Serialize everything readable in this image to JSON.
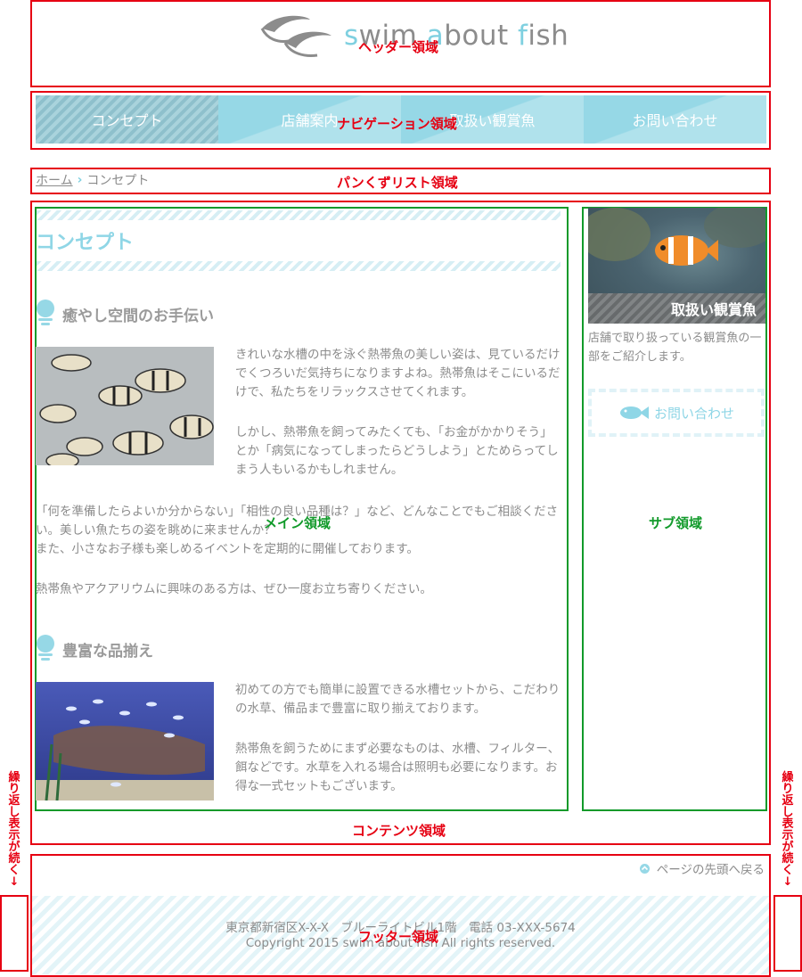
{
  "header": {
    "logo": {
      "pre": "s",
      "c1": "w",
      "mid": "im ",
      "c2": "a",
      "post": "bout ",
      "c3": "f",
      "end": "ish"
    },
    "region_label": "ヘッダー領域"
  },
  "nav": {
    "items": [
      {
        "label": "コンセプト"
      },
      {
        "label": "店舗案内"
      },
      {
        "label": "取扱い観賞魚"
      },
      {
        "label": "お問い合わせ"
      }
    ],
    "region_label": "ナビゲーション領域"
  },
  "breadcrumb": {
    "home": "ホーム",
    "separator": "›",
    "current": "コンセプト",
    "region_label": "パンくずリスト領域"
  },
  "main": {
    "title": "コンセプト",
    "region_label": "メイン領域",
    "sections": [
      {
        "heading": "癒やし空間のお手伝い",
        "paragraphs": [
          "きれいな水槽の中を泳ぐ熱帯魚の美しい姿は、見ているだけでくつろいだ気持ちになりますよね。熱帯魚はそこにいるだけで、私たちをリラックスさせてくれます。",
          "しかし、熱帯魚を飼ってみたくても、「お金がかかりそう」とか「病気になってしまったらどうしよう」とためらってしまう人もいるかもしれません。",
          "「何を準備したらよいか分からない」「相性の良い品種は？」など、どんなことでもご相談ください。美しい魚たちの姿を眺めに来ませんか？",
          "また、小さなお子様も楽しめるイベントを定期的に開催しております。",
          "熱帯魚やアクアリウムに興味のある方は、ぜひ一度お立ち寄りください。"
        ]
      },
      {
        "heading": "豊富な品揃え",
        "paragraphs": [
          "初めての方でも簡単に設置できる水槽セットから、こだわりの水草、備品まで豊富に取り揃えております。",
          "熱帯魚を飼うためにまず必要なものは、水槽、フィルター、餌などです。水草を入れる場合は照明も必要になります。お得な一式セットもございます。"
        ]
      }
    ]
  },
  "side": {
    "banner_caption": "取扱い観賞魚",
    "description": "店舗で取り扱っている観賞魚の一部をご紹介します。",
    "contact_button": "お問い合わせ",
    "region_label": "サブ領域"
  },
  "contents_region_label": "コンテンツ領域",
  "footer": {
    "pagetop": "ページの先頭へ戻る",
    "address": "東京都新宿区X-X-X　ブルーライトビル1階　電話 03-XXX-5674",
    "copyright": "Copyright 2015 swim about fish All rights reserved.",
    "region_label": "フッター領域"
  },
  "repeat_note": "繰り返し表示が続く↓",
  "colors": {
    "region_red": "#e60012",
    "region_green": "#119a2a",
    "accent": "#96d8e6",
    "text": "#8c8c8c"
  }
}
